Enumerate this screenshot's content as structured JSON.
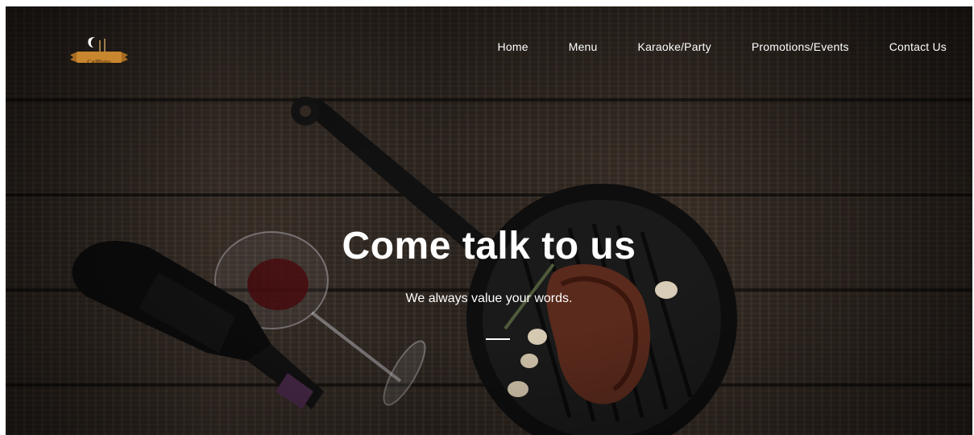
{
  "brand": {
    "logo_text": "CarlBistro",
    "logo_icon": "crescent-moon-icon",
    "ribbon_color": "#c8862e"
  },
  "nav": {
    "items": [
      {
        "label": "Home"
      },
      {
        "label": "Menu"
      },
      {
        "label": "Karaoke/Party"
      },
      {
        "label": "Promotions/Events"
      },
      {
        "label": "Contact Us"
      }
    ]
  },
  "hero": {
    "title": "Come talk to us",
    "subtitle": "We always value your words."
  },
  "colors": {
    "text": "#ffffff",
    "wood_dark": "#2a221c",
    "wood_light": "#3c3129"
  }
}
